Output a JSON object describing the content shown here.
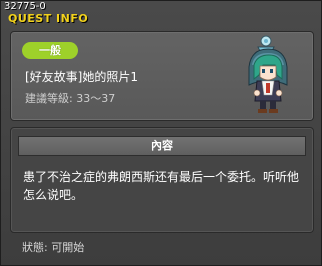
{
  "quest_id": "32775-0",
  "window_title": "QUEST INFO",
  "quest": {
    "category": "一般",
    "name": "[好友故事]她的照片1",
    "recommended_level": "建議等級: 33～37"
  },
  "details": {
    "header": "內容",
    "text": "患了不治之症的弗朗西斯还有最后一个委托。听听他怎么说吧。"
  },
  "status": "狀態:  可開始",
  "colors": {
    "title": "#f2d21c",
    "badge": "#9ed12a",
    "panel": "#5e5e5e",
    "background": "#3d3d3d"
  },
  "npc_icon": "green-haired-npc-sprite"
}
